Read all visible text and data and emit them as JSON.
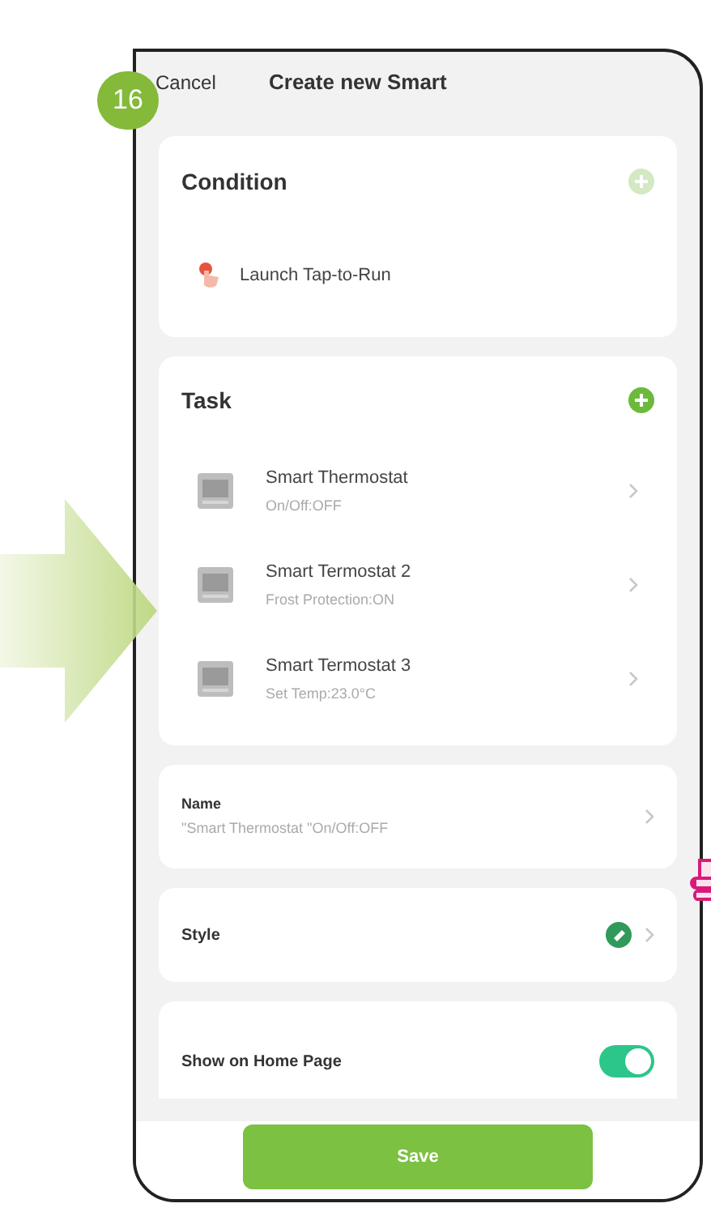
{
  "step_badge": "16",
  "header": {
    "cancel": "Cancel",
    "title": "Create new Smart"
  },
  "condition": {
    "title": "Condition",
    "add_disabled": true,
    "items": [
      {
        "label": "Launch Tap-to-Run"
      }
    ]
  },
  "task": {
    "title": "Task",
    "add_disabled": false,
    "items": [
      {
        "name": "Smart Thermostat",
        "detail": "On/Off:OFF"
      },
      {
        "name": "Smart Termostat 2",
        "detail": "Frost Protection:ON"
      },
      {
        "name": "Smart Termostat 3",
        "detail": "Set Temp:23.0°C"
      }
    ]
  },
  "name_row": {
    "label": "Name",
    "value": "\"Smart Thermostat \"On/Off:OFF"
  },
  "style_row": {
    "label": "Style"
  },
  "home_page_row": {
    "label": "Show on Home Page",
    "on": true
  },
  "save_button": "Save"
}
